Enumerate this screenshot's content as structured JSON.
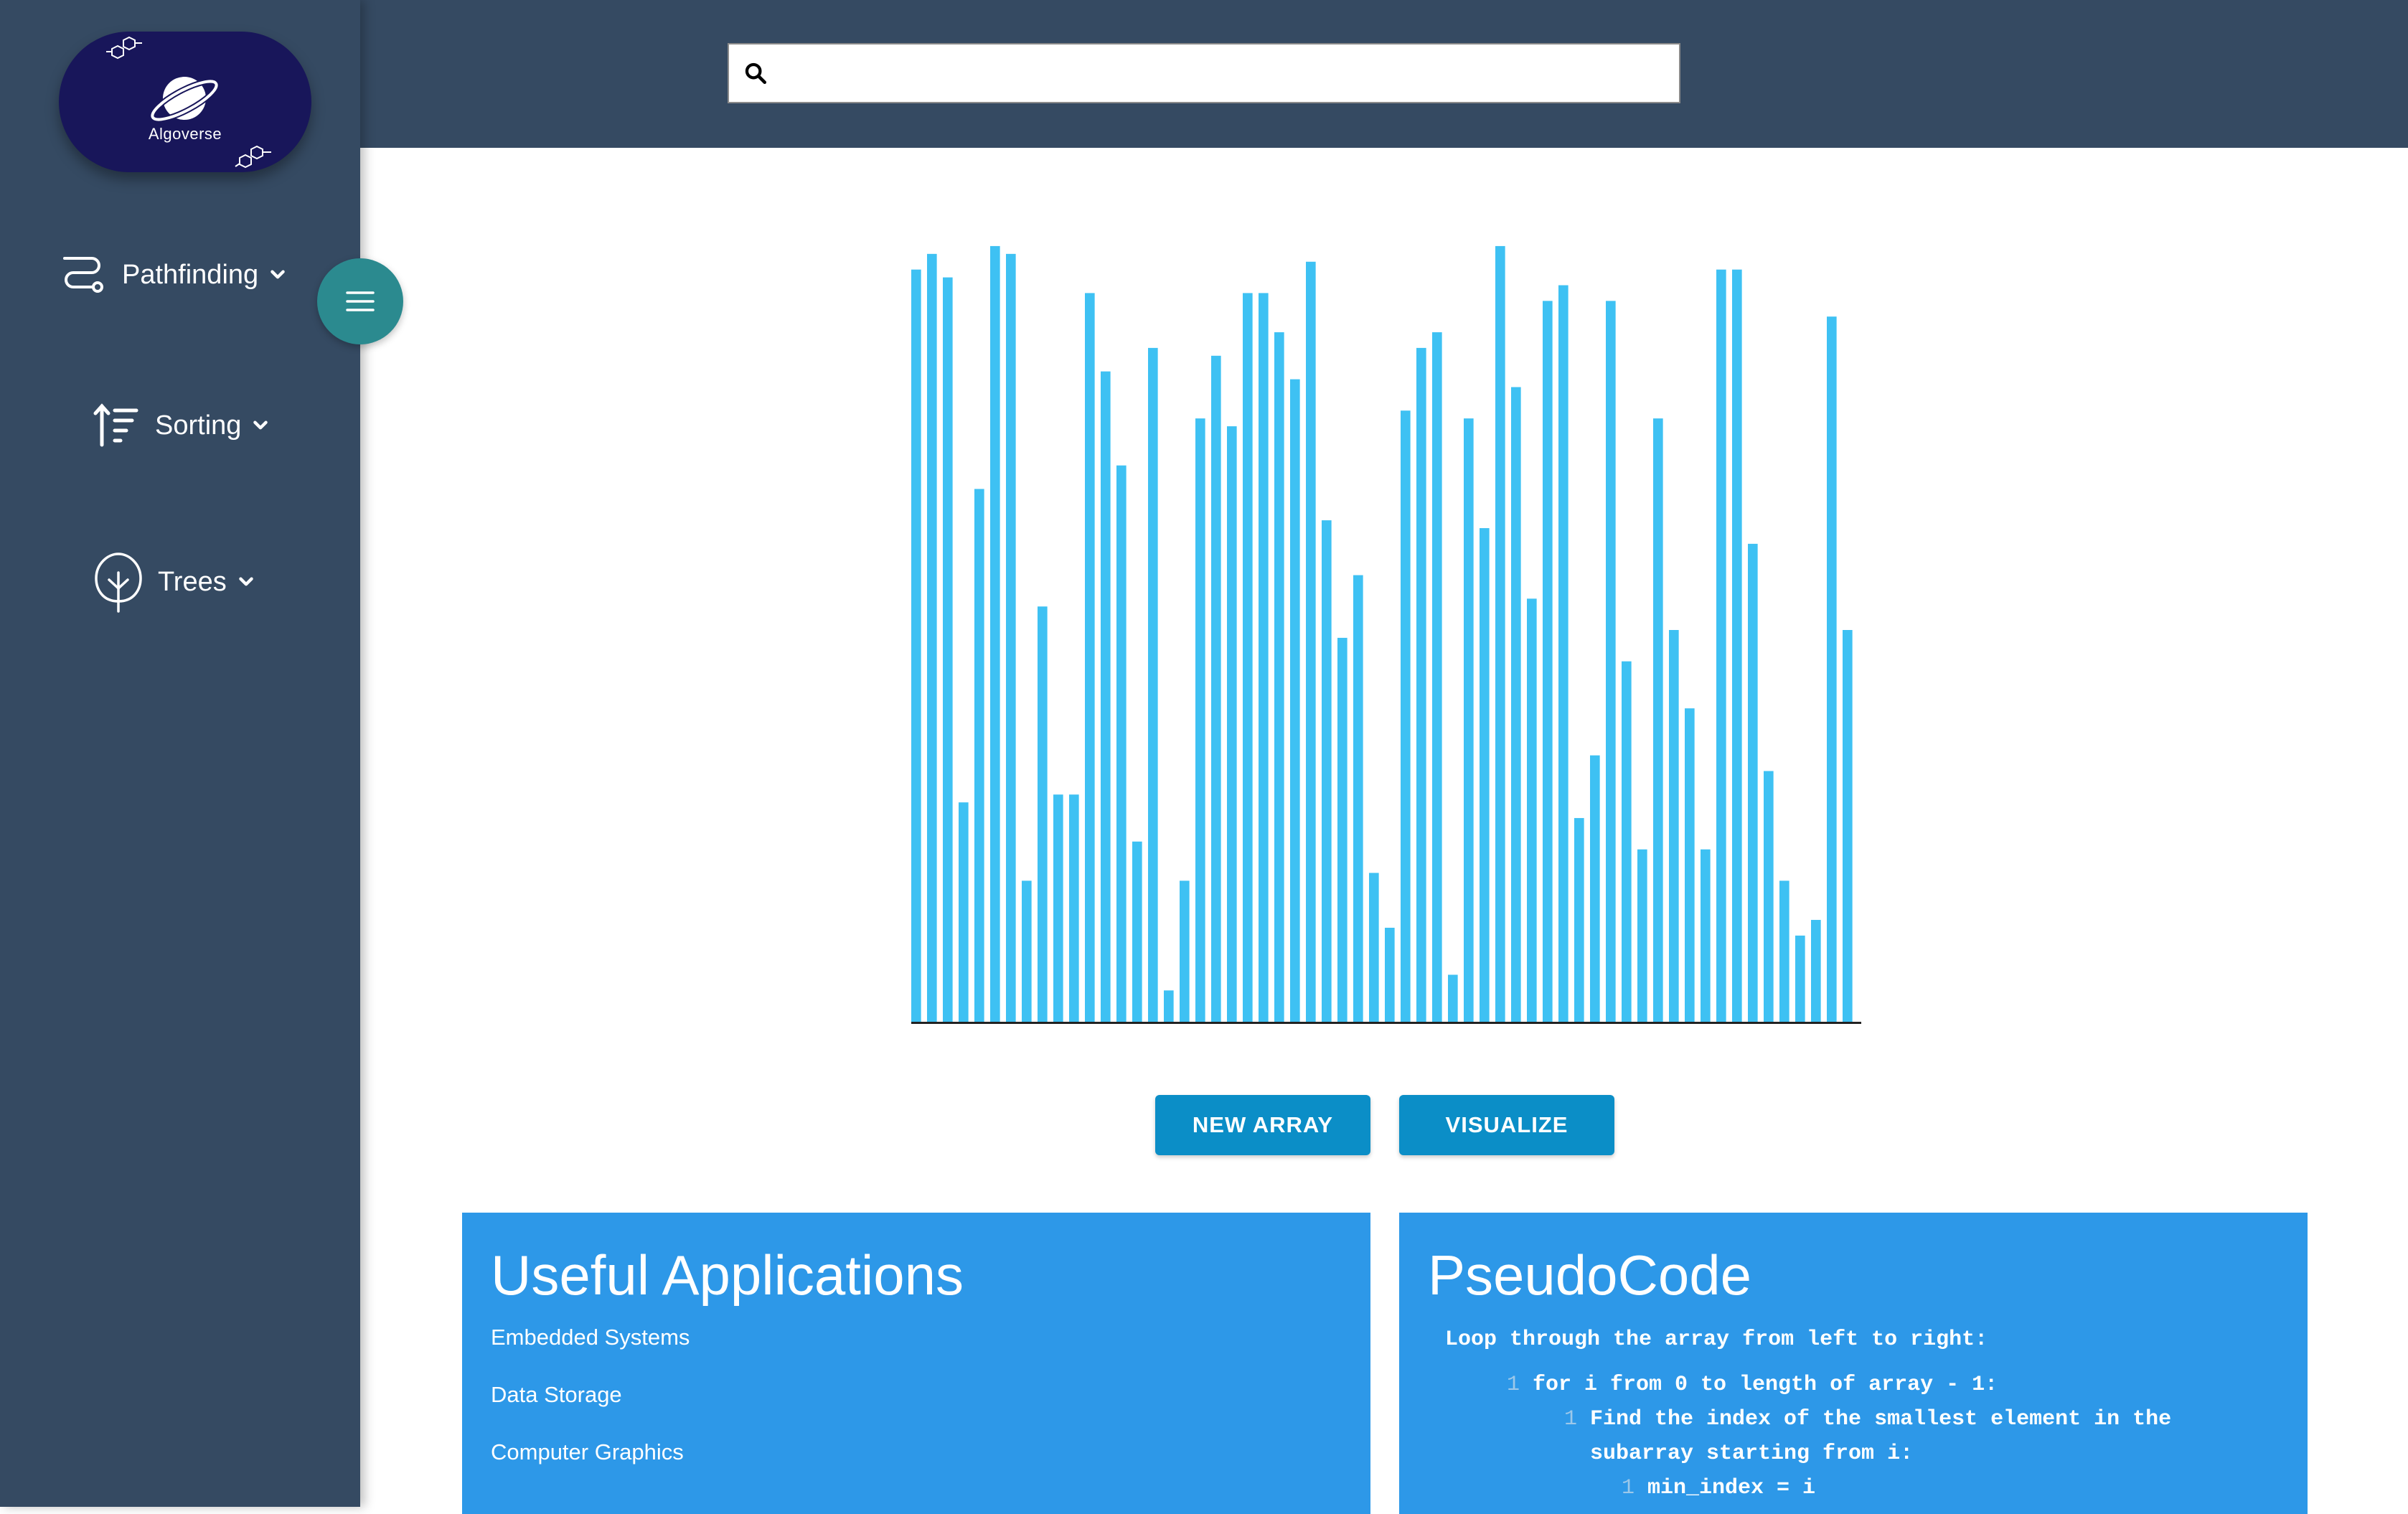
{
  "logo": {
    "text": "Algoverse"
  },
  "nav": {
    "items": [
      {
        "label": "Pathfinding",
        "icon": "route-icon"
      },
      {
        "label": "Sorting",
        "icon": "sort-icon"
      },
      {
        "label": "Trees",
        "icon": "tree-icon"
      }
    ]
  },
  "search": {
    "value": "",
    "placeholder": ""
  },
  "chart_data": {
    "type": "bar",
    "bar_color": "#3ec1f3",
    "ylim": [
      0,
      100
    ],
    "values": [
      96,
      98,
      95,
      28,
      68,
      99,
      98,
      18,
      53,
      29,
      29,
      93,
      83,
      71,
      23,
      86,
      4,
      18,
      77,
      85,
      76,
      93,
      93,
      88,
      82,
      97,
      64,
      49,
      57,
      19,
      12,
      78,
      86,
      88,
      6,
      77,
      63,
      99,
      81,
      54,
      92,
      94,
      26,
      34,
      92,
      46,
      22,
      77,
      50,
      40,
      22,
      96,
      96,
      61,
      32,
      18,
      11,
      13,
      90,
      50
    ]
  },
  "buttons": {
    "new_array": "NEW ARRAY",
    "visualize": "VISUALIZE"
  },
  "applications": {
    "title": "Useful Applications",
    "items": [
      "Embedded Systems",
      "Data Storage",
      "Computer Graphics"
    ]
  },
  "pseudocode": {
    "title": "PseudoCode",
    "lines": [
      {
        "number": "",
        "text": "Loop through the array from left to right:"
      },
      {
        "number": "1",
        "text": "for i from 0 to length of array - 1:"
      },
      {
        "number": "1",
        "text": "Find the index of the smallest element in the"
      },
      {
        "number": "",
        "text": "subarray starting from i:"
      },
      {
        "number": "1",
        "text": "min_index = i"
      }
    ]
  },
  "colors": {
    "sidebar": "#354a62",
    "accent_button": "#0b8ec7",
    "panel": "#2d98e8",
    "menu_toggle": "#2b8a8f",
    "logo_bg": "#18165a"
  }
}
